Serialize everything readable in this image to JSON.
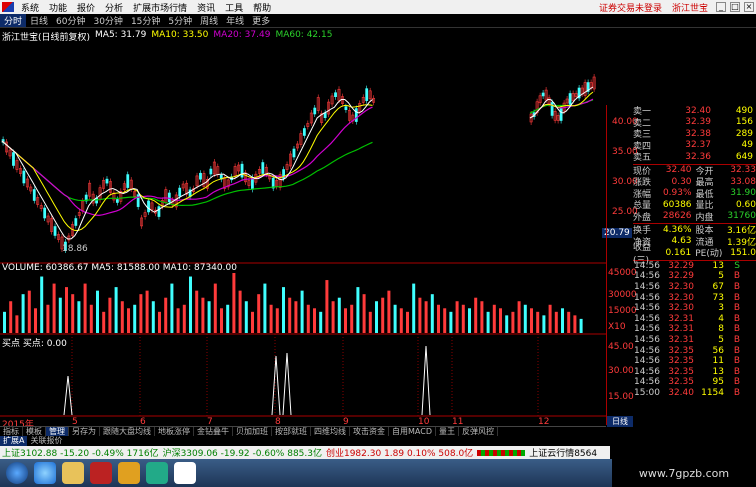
{
  "menubar": {
    "items": [
      "系统",
      "功能",
      "报价",
      "分析",
      "扩展市场行情",
      "资讯",
      "工具",
      "帮助"
    ],
    "status": "证券交易未登录",
    "broker": "浙江世宝"
  },
  "tabs": [
    "分时",
    "日线",
    "60分钟",
    "30分钟",
    "15分钟",
    "5分钟",
    "周线",
    "年线",
    "更多"
  ],
  "ma_line": {
    "stock": "浙江世宝(日线前复权)",
    "ma5": "MA5: 31.79",
    "ma10": "MA10: 33.50",
    "ma20": "MA20: 37.49",
    "ma60": "MA60: 42.15"
  },
  "colors": {
    "up": "#ff3b3b",
    "down": "#40ffff",
    "ma5": "#ffffff",
    "ma10": "#ffff00",
    "ma20": "#d000d0",
    "ma60": "#00c000"
  },
  "price_labels": [
    "40.00",
    "35.00",
    "30.00",
    "25.00",
    "20.79"
  ],
  "low_label": "18.86",
  "volume": {
    "header": "VOLUME: 60386.67  MA5: 81588.00  MA10: 87340.00",
    "axis": [
      "45000",
      "30000",
      "15000",
      "X10"
    ],
    "values": [
      30,
      45,
      25,
      55,
      60,
      35,
      80,
      40,
      70,
      50,
      65,
      55,
      45,
      70,
      40,
      60,
      30,
      50,
      65,
      45,
      35,
      40,
      55,
      60,
      45,
      30,
      50,
      70,
      35,
      40,
      80,
      60,
      50,
      45,
      70,
      35,
      40,
      85,
      60,
      45,
      30,
      55,
      70,
      40,
      35,
      65,
      50,
      45,
      60,
      40,
      35,
      30,
      75,
      45,
      50,
      35,
      40,
      65,
      55,
      30,
      45,
      50,
      60,
      40,
      35,
      30,
      70,
      50,
      45,
      55,
      40,
      35,
      30,
      45,
      40,
      35,
      50,
      45,
      30,
      40,
      35,
      25,
      30,
      45,
      40,
      35,
      30,
      25,
      40,
      30,
      35,
      30,
      25,
      20
    ]
  },
  "indicator": {
    "header": "买点  买点: 0.00",
    "axis": [
      "45.00",
      "30.00",
      "15.00"
    ]
  },
  "x_labels": [
    "2015年",
    "5",
    "6",
    "7",
    "8",
    "9",
    "10",
    "11",
    "12"
  ],
  "quote": {
    "sells": [
      {
        "label": "卖一",
        "price": "32.40",
        "vol": "490"
      },
      {
        "label": "卖二",
        "price": "32.39",
        "vol": "156"
      },
      {
        "label": "卖三",
        "price": "32.38",
        "vol": "289"
      },
      {
        "label": "卖四",
        "price": "32.37",
        "vol": "49"
      },
      {
        "label": "卖五",
        "price": "32.36",
        "vol": "649"
      }
    ],
    "stats": [
      {
        "l1": "现价",
        "v1": "32.40",
        "l2": "今开",
        "v2": "32.33"
      },
      {
        "l1": "涨跌",
        "v1": "0.30",
        "l2": "最高",
        "v2": "33.08"
      },
      {
        "l1": "涨幅",
        "v1": "0.93%",
        "l2": "最低",
        "v2": "31.90"
      },
      {
        "l1": "总量",
        "v1": "60386",
        "l2": "量比",
        "v2": "0.60"
      },
      {
        "l1": "外盘",
        "v1": "28626",
        "l2": "内盘",
        "v2": "31760"
      },
      {
        "l1": "换手",
        "v1": "4.36%",
        "l2": "股本",
        "v2": "3.16亿"
      },
      {
        "l1": "净资",
        "v1": "4.63",
        "l2": "流通",
        "v2": "1.39亿"
      },
      {
        "l1": "收益(三)",
        "v1": "0.161",
        "l2": "PE(动)",
        "v2": "151.0"
      }
    ],
    "ticks": [
      {
        "t": "14:56",
        "p": "32.29",
        "v": "13",
        "s": "S"
      },
      {
        "t": "14:56",
        "p": "32.29",
        "v": "5",
        "s": "B"
      },
      {
        "t": "14:56",
        "p": "32.30",
        "v": "67",
        "s": "B"
      },
      {
        "t": "14:56",
        "p": "32.30",
        "v": "73",
        "s": "B"
      },
      {
        "t": "14:56",
        "p": "32.30",
        "v": "3",
        "s": "B"
      },
      {
        "t": "14:56",
        "p": "32.31",
        "v": "4",
        "s": "B"
      },
      {
        "t": "14:56",
        "p": "32.31",
        "v": "8",
        "s": "B"
      },
      {
        "t": "14:56",
        "p": "32.31",
        "v": "5",
        "s": "B"
      },
      {
        "t": "14:56",
        "p": "32.35",
        "v": "56",
        "s": "B"
      },
      {
        "t": "14:56",
        "p": "32.35",
        "v": "11",
        "s": "B"
      },
      {
        "t": "14:56",
        "p": "32.35",
        "v": "13",
        "s": "B"
      },
      {
        "t": "14:56",
        "p": "32.35",
        "v": "95",
        "s": "B"
      },
      {
        "t": "15:00",
        "p": "32.40",
        "v": "1154",
        "s": "B"
      }
    ],
    "page_tab": "日线"
  },
  "bottom_tabs": [
    "指标",
    "模板",
    "管理",
    "另存为",
    "跟随大盘均线",
    "地板涨停",
    "金钻叠牛",
    "贝加加班",
    "按部就班",
    "四维均线",
    "攻击资金",
    "自用MACD",
    "量王",
    "反弹风控"
  ],
  "bottom_tabs2": [
    "扩展A",
    "关联报价"
  ],
  "statusbar": {
    "sh": "上证3102.88 -15.20 -0.49% 1716亿",
    "hs": "沪深3309.06 -19.92 -0.60% 885.3亿",
    "cy": "创业1982.30 1.89 0.10% 508.0亿",
    "cloud": "上证云行情8564"
  },
  "watermark": "www.7gpzb.com"
}
